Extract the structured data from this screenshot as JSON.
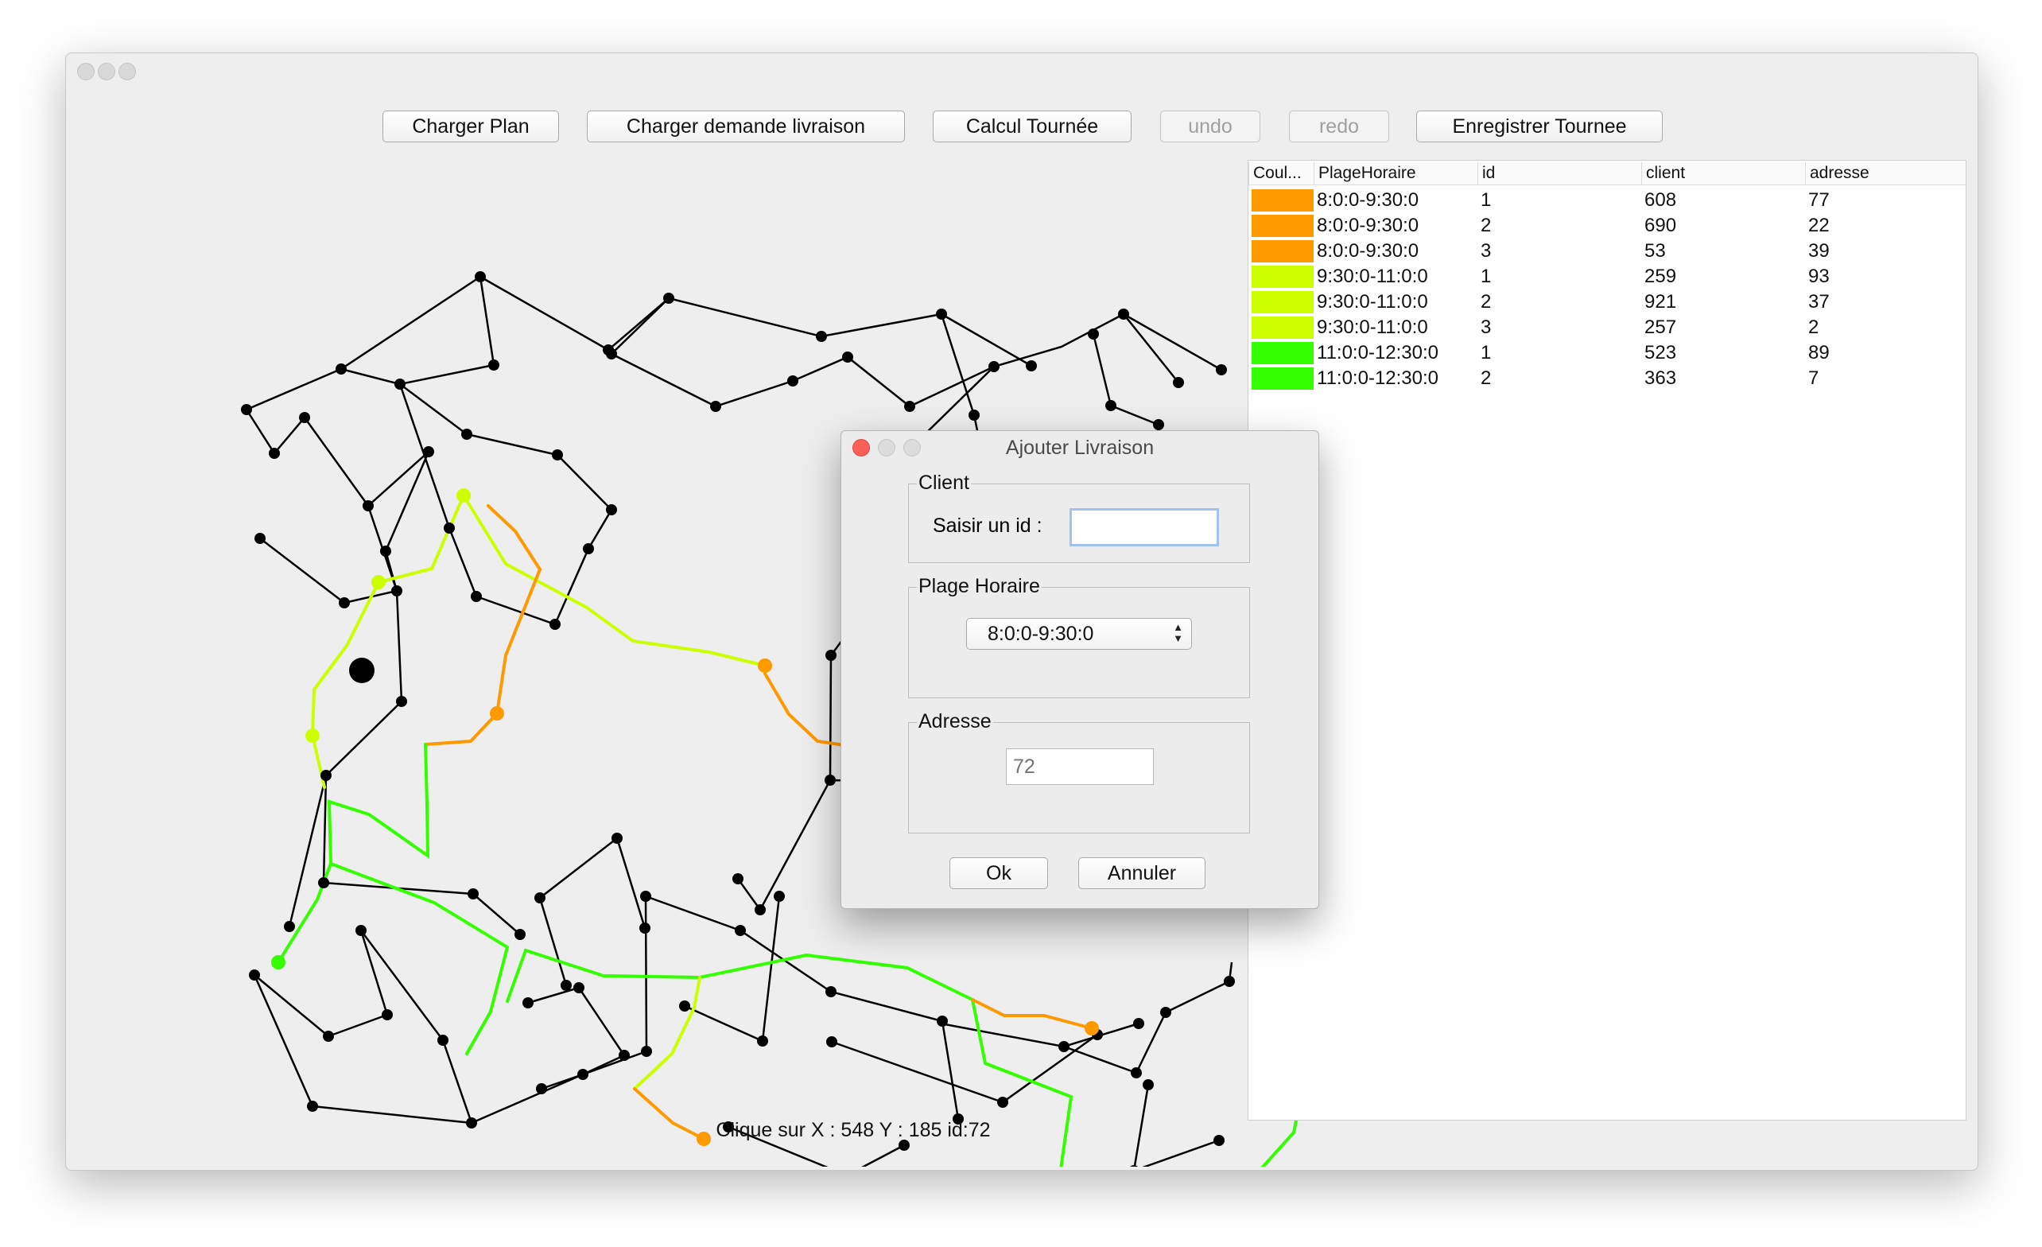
{
  "toolbar": {
    "load_map": "Charger Plan",
    "load_request": "Charger demande livraison",
    "compute_route": "Calcul Tournée",
    "undo": "undo",
    "redo": "redo",
    "save_route": "Enregistrer Tournee"
  },
  "table": {
    "headers": [
      "Coul...",
      "PlageHoraire",
      "id",
      "client",
      "adresse"
    ],
    "rows": [
      {
        "color": "#ff9900",
        "slot": "8:0:0-9:30:0",
        "id": "1",
        "client": "608",
        "address": "77"
      },
      {
        "color": "#ff9900",
        "slot": "8:0:0-9:30:0",
        "id": "2",
        "client": "690",
        "address": "22"
      },
      {
        "color": "#ff9900",
        "slot": "8:0:0-9:30:0",
        "id": "3",
        "client": "53",
        "address": "39"
      },
      {
        "color": "#ccff00",
        "slot": "9:30:0-11:0:0",
        "id": "1",
        "client": "259",
        "address": "93"
      },
      {
        "color": "#ccff00",
        "slot": "9:30:0-11:0:0",
        "id": "2",
        "client": "921",
        "address": "37"
      },
      {
        "color": "#ccff00",
        "slot": "9:30:0-11:0:0",
        "id": "3",
        "client": "257",
        "address": "2"
      },
      {
        "color": "#33ff00",
        "slot": "11:0:0-12:30:0",
        "id": "1",
        "client": "523",
        "address": "89"
      },
      {
        "color": "#33ff00",
        "slot": "11:0:0-12:30:0",
        "id": "2",
        "client": "363",
        "address": "7"
      }
    ]
  },
  "status": "Clique sur X : 548 Y : 185 id:72",
  "dialog": {
    "title": "Ajouter Livraison",
    "client_legend": "Client",
    "client_label": "Saisir un id :",
    "client_value": "",
    "slot_legend": "Plage Horaire",
    "slot_selected": "8:0:0-9:30:0",
    "address_legend": "Adresse",
    "address_placeholder": "72",
    "ok": "Ok",
    "cancel": "Annuler"
  },
  "colors": {
    "slot1": "#ff9900",
    "slot2": "#ccff00",
    "slot3": "#33ff00",
    "edge": "#000000"
  }
}
